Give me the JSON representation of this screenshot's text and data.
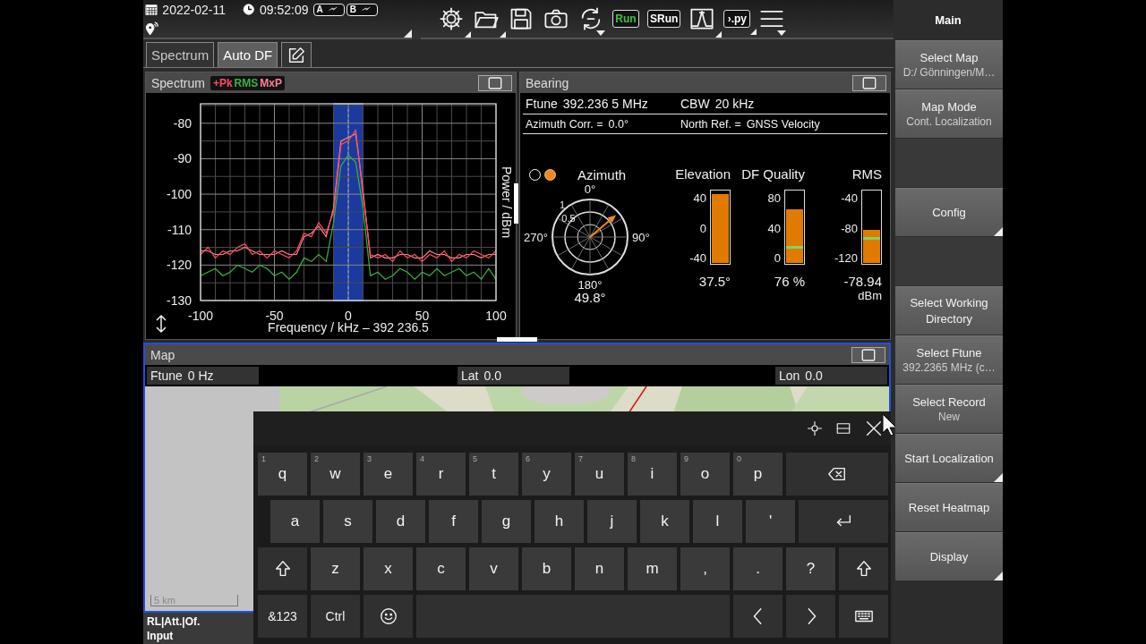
{
  "status": {
    "date": "2022-02-11",
    "time": "09:52:09",
    "batteries": [
      {
        "label": "A"
      },
      {
        "label": "B"
      }
    ]
  },
  "toolbar": [
    {
      "kind": "gear",
      "submenu": true
    },
    {
      "kind": "folder",
      "submenu": true
    },
    {
      "kind": "save",
      "submenu": false
    },
    {
      "kind": "camera",
      "submenu": false
    },
    {
      "kind": "refresh",
      "dropdown": true
    },
    {
      "kind": "text",
      "label": "Run",
      "highlighted": true
    },
    {
      "kind": "text",
      "label": "SRun",
      "highlighted": false
    },
    {
      "kind": "spectrum",
      "submenu": true
    },
    {
      "kind": "text",
      "label": "›.py",
      "highlighted": false,
      "submenu": true
    },
    {
      "kind": "menu",
      "dropdown": true
    }
  ],
  "tabs": [
    {
      "kind": "text",
      "label": "Spectrum",
      "selected": false
    },
    {
      "kind": "text",
      "label": "Auto DF",
      "selected": true
    },
    {
      "kind": "edit",
      "selected": false
    }
  ],
  "spectrum": {
    "title": "Spectrum",
    "focused": false,
    "chart_data": {
      "type": "line",
      "grid": true,
      "xlabel": "Frequency / kHz – 392 236.5",
      "ylabel": "Power / dBm",
      "x": [
        -100,
        -95,
        -90,
        -85,
        -80,
        -75,
        -70,
        -65,
        -60,
        -55,
        -50,
        -45,
        -40,
        -35,
        -30,
        -25,
        -20,
        -15,
        -10,
        -5,
        0,
        5,
        10,
        15,
        20,
        25,
        30,
        35,
        40,
        45,
        50,
        55,
        60,
        65,
        70,
        75,
        80,
        85,
        90,
        95,
        100
      ],
      "series": [
        {
          "name": "+Pk",
          "color": "#ff4d5e",
          "values": [
            -117,
            -115,
            -118,
            -116,
            -117,
            -115,
            -114,
            -117,
            -116,
            -118,
            -116,
            -117,
            -118,
            -116,
            -111,
            -112,
            -108,
            -111,
            -105,
            -86,
            -85,
            -82,
            -100,
            -117,
            -118,
            -117,
            -119,
            -116,
            -118,
            -117,
            -119,
            -117,
            -118,
            -116,
            -119,
            -117,
            -118,
            -116,
            -117,
            -118,
            -116
          ]
        },
        {
          "name": "RMS",
          "color": "#3cb043",
          "values": [
            -123,
            -122,
            -121,
            -123,
            -122,
            -120,
            -121,
            -122,
            -120,
            -121,
            -123,
            -122,
            -124,
            -122,
            -118,
            -119,
            -117,
            -119,
            -108,
            -92,
            -89,
            -91,
            -104,
            -123,
            -122,
            -124,
            -123,
            -121,
            -122,
            -124,
            -122,
            -123,
            -121,
            -123,
            -122,
            -121,
            -123,
            -122,
            -124,
            -121,
            -124
          ]
        },
        {
          "name": "MxP",
          "color": "#ff8095",
          "values": [
            -116,
            -116,
            -117,
            -117,
            -116,
            -116,
            -115,
            -116,
            -117,
            -117,
            -117,
            -116,
            -117,
            -117,
            -112,
            -111,
            -109,
            -112,
            -104,
            -85,
            -84,
            -83,
            -99,
            -118,
            -117,
            -118,
            -118,
            -117,
            -117,
            -118,
            -118,
            -116,
            -117,
            -117,
            -118,
            -118,
            -117,
            -117,
            -118,
            -117,
            -117
          ]
        }
      ],
      "xlim": [
        -100,
        100
      ],
      "ylim": [
        -130,
        -74.5
      ],
      "xticks": [
        -100,
        -50,
        0,
        50,
        100
      ],
      "yticks": [
        -130,
        -120,
        -110,
        -100,
        -90,
        -80
      ]
    }
  },
  "bearing": {
    "title": "Bearing",
    "focused": false,
    "info": [
      [
        {
          "label": "Ftune",
          "value": "392.236 5 MHz"
        },
        {
          "label": "CBW",
          "value": "20 kHz"
        }
      ],
      [
        {
          "label": "Azimuth Corr. =",
          "value": "0.0°"
        },
        {
          "label": "North Ref. =",
          "value": "GNSS Velocity"
        }
      ]
    ],
    "azimuth": {
      "title": "Azimuth",
      "indicators": [
        {
          "on": false
        },
        {
          "on": true
        }
      ],
      "compass_labels": [
        "0°",
        "90°",
        "180°",
        "270°"
      ],
      "ring_labels": [
        "1",
        "0.5"
      ],
      "value": "49.8°"
    },
    "meters": [
      {
        "title": "Elevation",
        "ticks": [
          "40",
          "0",
          "-40"
        ],
        "level": 0.97,
        "value": "37.5°"
      },
      {
        "title": "DF Quality",
        "ticks": [
          "80",
          "40",
          "0"
        ],
        "level": 0.76,
        "threshold": {
          "level": 0.2
        },
        "value": "76 %"
      },
      {
        "title": "RMS",
        "ticks": [
          "-40",
          "-80",
          "-120"
        ],
        "level": 0.47,
        "threshold": {
          "level": 0.33
        },
        "value": "-78.94",
        "unit": "dBm"
      }
    ]
  },
  "map": {
    "title": "Map",
    "focused": true,
    "info": [
      {
        "label": "Ftune",
        "value": "0 Hz"
      },
      {
        "label": "Lat",
        "value": "0.0"
      },
      {
        "label": "Lon",
        "value": "0.0"
      }
    ],
    "scale": "5 km"
  },
  "bottom_status": [
    "RL|Att.|Of.",
    "Input"
  ],
  "keyboard": {
    "rows": [
      [
        {
          "label": "q",
          "hint": "1"
        },
        {
          "label": "w",
          "hint": "2"
        },
        {
          "label": "e",
          "hint": "3"
        },
        {
          "label": "r",
          "hint": "4"
        },
        {
          "label": "t",
          "hint": "5"
        },
        {
          "label": "y",
          "hint": "6"
        },
        {
          "label": "u",
          "hint": "7"
        },
        {
          "label": "i",
          "hint": "8"
        },
        {
          "label": "o",
          "hint": "9"
        },
        {
          "label": "p",
          "hint": "0"
        },
        {
          "kind": "backspace"
        }
      ],
      [
        {
          "label": "a"
        },
        {
          "label": "s"
        },
        {
          "label": "d"
        },
        {
          "label": "f"
        },
        {
          "label": "g"
        },
        {
          "label": "h"
        },
        {
          "label": "j"
        },
        {
          "label": "k"
        },
        {
          "label": "l"
        },
        {
          "label": "'"
        },
        {
          "kind": "enter"
        }
      ],
      [
        {
          "kind": "shift"
        },
        {
          "label": "z"
        },
        {
          "label": "x"
        },
        {
          "label": "c"
        },
        {
          "label": "v"
        },
        {
          "label": "b"
        },
        {
          "label": "n"
        },
        {
          "label": "m"
        },
        {
          "label": ","
        },
        {
          "label": "."
        },
        {
          "label": "?"
        },
        {
          "kind": "shift"
        }
      ],
      [
        {
          "label": "&123"
        },
        {
          "label": "Ctrl"
        },
        {
          "kind": "emoji"
        },
        {
          "kind": "space"
        },
        {
          "kind": "left"
        },
        {
          "kind": "right"
        },
        {
          "kind": "keyboard"
        }
      ]
    ]
  },
  "sidebar": {
    "title": "Main",
    "items": [
      {
        "label": "Select Map",
        "sub": "D:/ Gönningen/M…",
        "submenu": false
      },
      {
        "label": "Map Mode",
        "sub": "Cont. Localization",
        "submenu": false
      },
      {
        "kind": "empty"
      },
      {
        "label": "Config",
        "submenu": true
      },
      {
        "kind": "empty"
      },
      {
        "label": "Select Working Directory",
        "submenu": false
      },
      {
        "label": "Select Ftune",
        "sub": "392.2365 MHz (c…",
        "submenu": false
      },
      {
        "label": "Select Record",
        "sub": "New",
        "submenu": false
      },
      {
        "label": "Start Localization",
        "submenu": true
      },
      {
        "label": "Reset Heatmap",
        "submenu": false
      },
      {
        "label": "Display",
        "submenu": true
      }
    ]
  }
}
